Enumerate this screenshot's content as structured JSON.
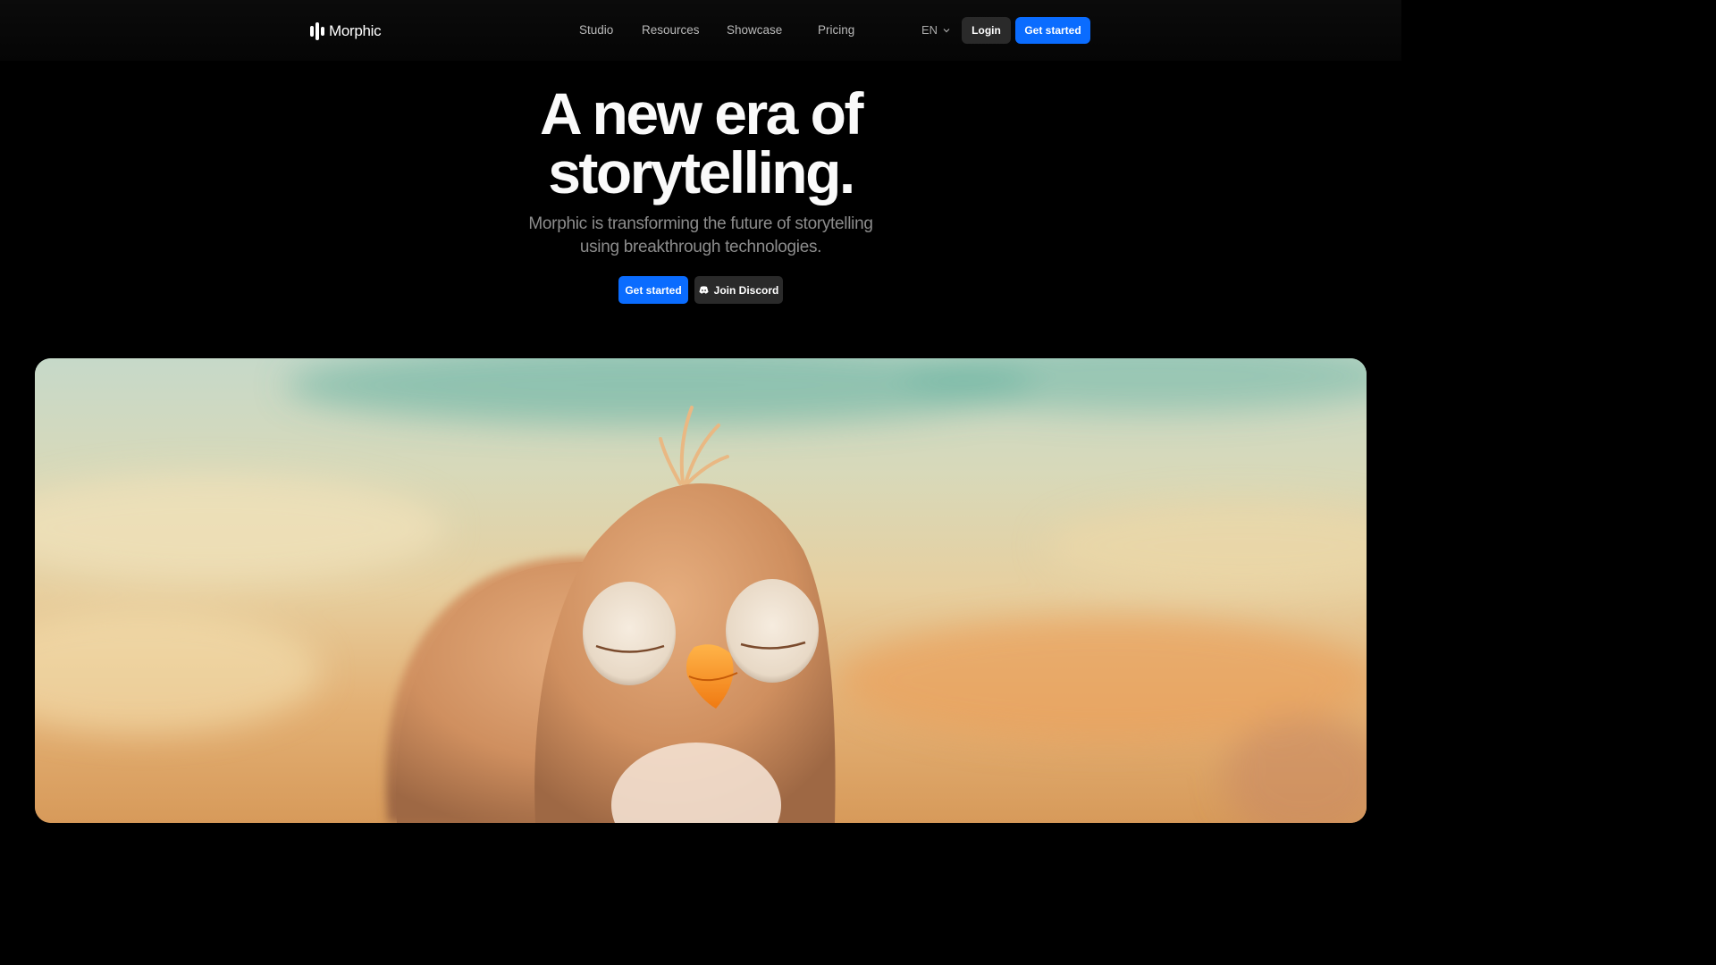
{
  "brand": {
    "name": "Morphic"
  },
  "nav": {
    "links": [
      {
        "label": "Studio"
      },
      {
        "label": "Resources"
      },
      {
        "label": "Showcase"
      },
      {
        "label": "Pricing"
      }
    ],
    "language": "EN",
    "login_label": "Login",
    "cta_label": "Get started"
  },
  "hero": {
    "title_line1": "A new era of",
    "title_line2": "storytelling.",
    "subtitle_line1": "Morphic is transforming the future of storytelling",
    "subtitle_line2": "using breakthrough technologies.",
    "primary_button": "Get started",
    "discord_button": "Join Discord"
  },
  "media": {
    "subject": "plush bird character on a sunny beach"
  },
  "colors": {
    "accent": "#0a6cff",
    "background": "#000000",
    "button_dark": "#2a2a2a"
  },
  "icons": {
    "logo": "morphic-logo-icon",
    "language_chevron": "chevron-down-icon",
    "discord": "discord-icon"
  }
}
